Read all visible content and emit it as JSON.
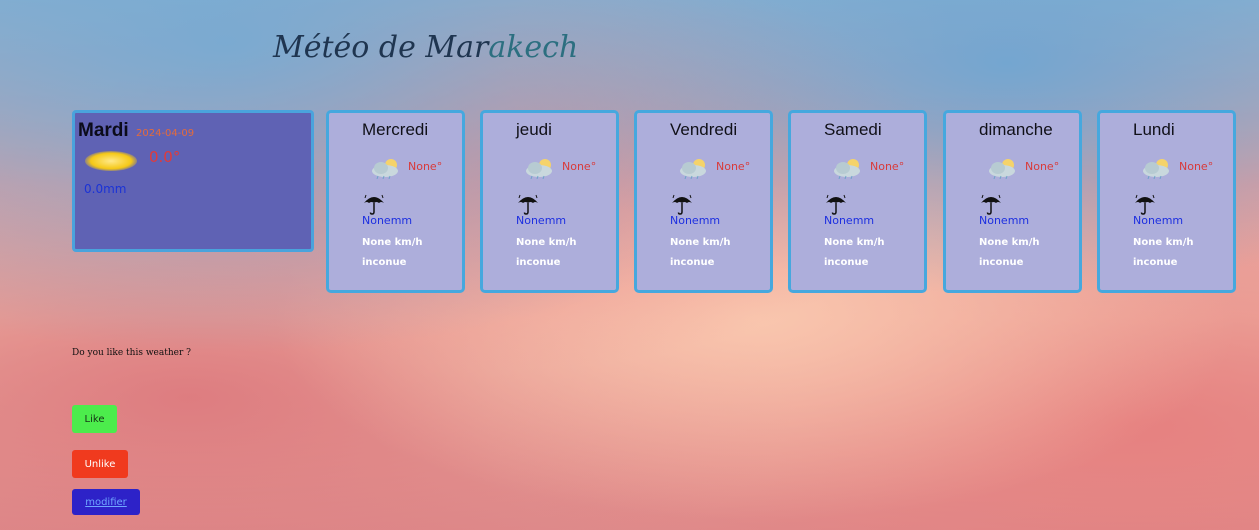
{
  "title": {
    "part1": "Météo de Mar",
    "part2": "akech"
  },
  "today": {
    "day": "Mardi",
    "date": "2024-04-09",
    "icon": "sun-icon",
    "temp": "0.0°",
    "rain": "0.0mm"
  },
  "forecast": [
    {
      "day": "Mercredi",
      "temp": "None°",
      "rain": "Nonemm",
      "wind": "None km/h",
      "condition": "inconue"
    },
    {
      "day": "jeudi",
      "temp": "None°",
      "rain": "Nonemm",
      "wind": "None km/h",
      "condition": "inconue"
    },
    {
      "day": "Vendredi",
      "temp": "None°",
      "rain": "Nonemm",
      "wind": "None km/h",
      "condition": "inconue"
    },
    {
      "day": "Samedi",
      "temp": "None°",
      "rain": "Nonemm",
      "wind": "None km/h",
      "condition": "inconue"
    },
    {
      "day": "dimanche",
      "temp": "None°",
      "rain": "Nonemm",
      "wind": "None km/h",
      "condition": "inconue"
    },
    {
      "day": "Lundi",
      "temp": "None°",
      "rain": "Nonemm",
      "wind": "None km/h",
      "condition": "inconue"
    }
  ],
  "feedback": {
    "question": "Do you like this weather ?",
    "like_label": "Like",
    "unlike_label": "Unlike",
    "modify_label": "modifier"
  },
  "colors": {
    "card_bg": "#adaedb",
    "card_border": "#46a8de",
    "today_bg": "#5f62b4",
    "like": "#4cec4c",
    "unlike": "#f03a1e",
    "modify": "#2d22c8"
  }
}
